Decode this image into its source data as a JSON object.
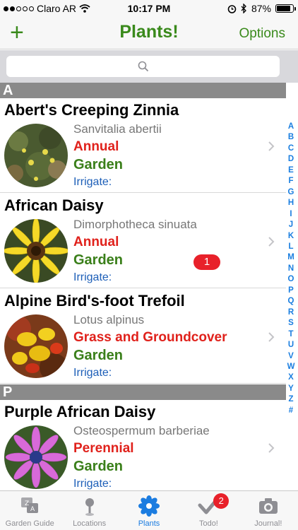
{
  "statusbar": {
    "carrier": "Claro AR",
    "time": "10:17 PM",
    "battery": "87%",
    "battery_level": 0.87
  },
  "navbar": {
    "add_label": "+",
    "title": "Plants!",
    "options_label": "Options"
  },
  "search": {
    "placeholder": ""
  },
  "sections": [
    "A",
    "P"
  ],
  "plants": [
    {
      "name": "Abert's Creeping Zinnia",
      "scientific": "Sanvitalia abertii",
      "type": "Annual",
      "location": "Garden",
      "irrigate": "Irrigate:"
    },
    {
      "name": "African Daisy",
      "scientific": "Dimorphotheca sinuata",
      "type": "Annual",
      "location": "Garden",
      "irrigate": "Irrigate:",
      "badge": "1"
    },
    {
      "name": "Alpine Bird's-foot Trefoil",
      "scientific": "Lotus alpinus",
      "type": "Grass and Groundcover",
      "location": "Garden",
      "irrigate": "Irrigate:"
    },
    {
      "name": "Purple African Daisy",
      "scientific": "Osteospermum barberiae",
      "type": "Perennial",
      "location": "Garden",
      "irrigate": "Irrigate:"
    }
  ],
  "index": [
    "A",
    "B",
    "C",
    "D",
    "E",
    "F",
    "G",
    "H",
    "I",
    "J",
    "K",
    "L",
    "M",
    "N",
    "O",
    "P",
    "Q",
    "R",
    "S",
    "T",
    "U",
    "V",
    "W",
    "X",
    "Y",
    "Z",
    "#"
  ],
  "tabs": [
    {
      "label": "Garden Guide",
      "icon": "garden-guide-icon"
    },
    {
      "label": "Locations",
      "icon": "location-pin-icon"
    },
    {
      "label": "Plants",
      "icon": "flower-icon",
      "active": true
    },
    {
      "label": "Todo!",
      "icon": "checkmark-icon",
      "badge": "2"
    },
    {
      "label": "Journal!",
      "icon": "camera-icon"
    }
  ],
  "colors": {
    "accent_green": "#3a8a1c",
    "plant_type_red": "#e0211b",
    "garden_green": "#3a7f1a",
    "irrigate_blue": "#1d5fb8",
    "index_blue": "#1a7ee0",
    "badge_red": "#e8212a",
    "section_gray": "#8a8a8a"
  }
}
